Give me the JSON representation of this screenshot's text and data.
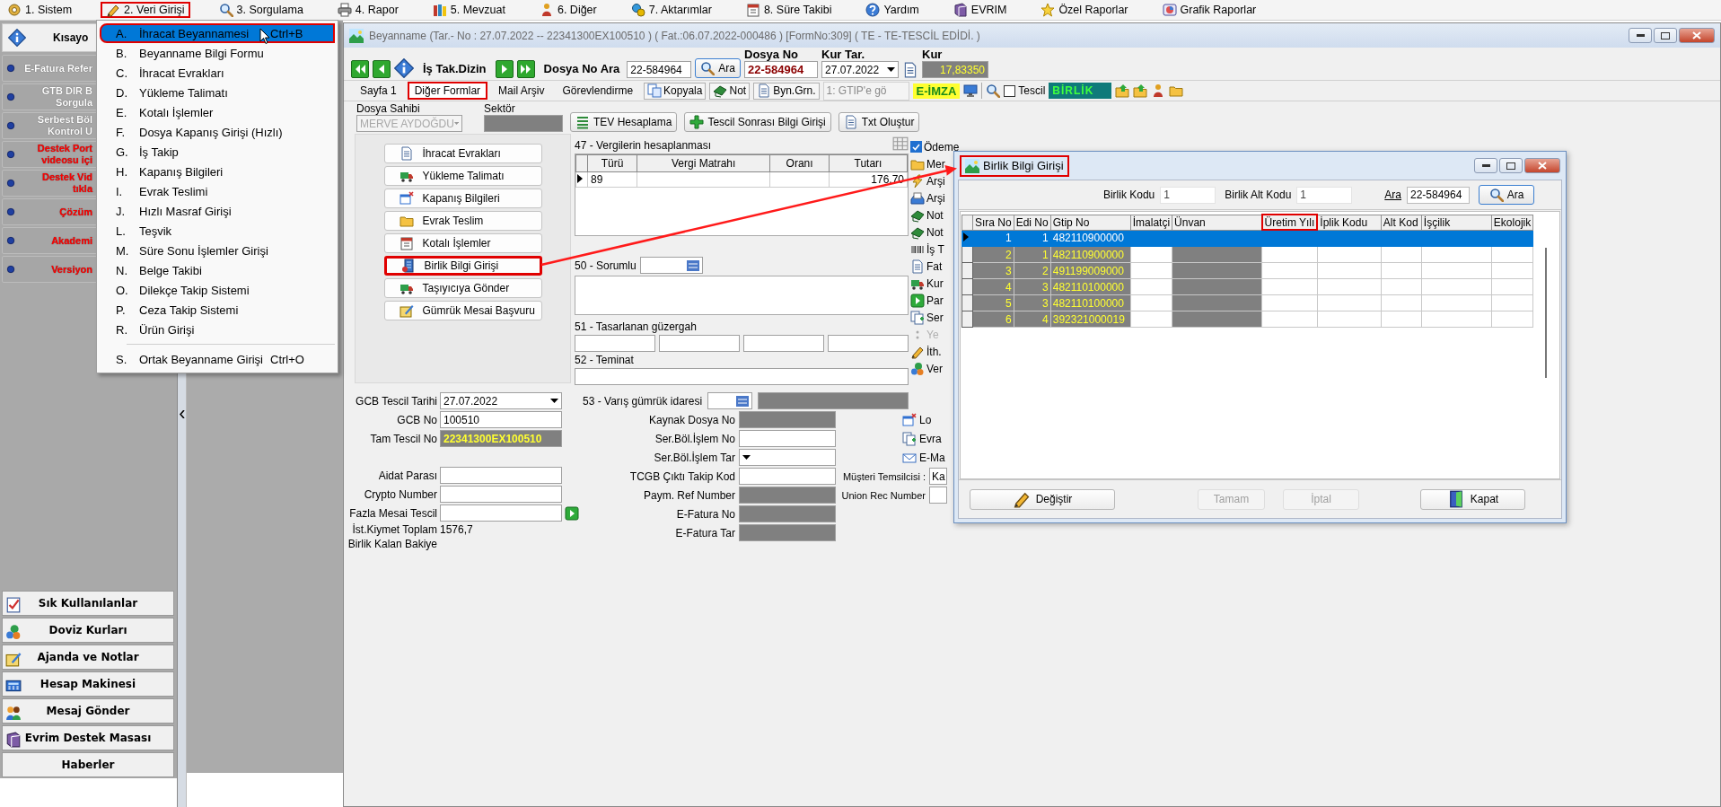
{
  "menu": [
    {
      "label": "1. Sistem",
      "highlighted": false
    },
    {
      "label": "2. Veri Girişi",
      "highlighted": true
    },
    {
      "label": "3. Sorgulama",
      "highlighted": false
    },
    {
      "label": "4. Rapor",
      "highlighted": false
    },
    {
      "label": "5. Mevzuat",
      "highlighted": false
    },
    {
      "label": "6. Diğer",
      "highlighted": false
    },
    {
      "label": "7. Aktarımlar",
      "highlighted": false
    },
    {
      "label": "8. Süre Takibi",
      "highlighted": false
    },
    {
      "label": "Yardım",
      "highlighted": false
    },
    {
      "label": "EVRIM",
      "highlighted": false
    },
    {
      "label": "Özel Raporlar",
      "highlighted": false
    },
    {
      "label": "Grafik Raporlar",
      "highlighted": false
    }
  ],
  "dropdown": {
    "items": [
      {
        "key": "A.",
        "label": "İhracat Beyannamesi",
        "shortcut": "Ctrl+B",
        "selected": true
      },
      {
        "key": "B.",
        "label": "Beyanname Bilgi Formu",
        "selected": false
      },
      {
        "key": "C.",
        "label": "İhracat Evrakları",
        "selected": false
      },
      {
        "key": "D.",
        "label": "Yükleme Talimatı",
        "selected": false
      },
      {
        "key": "E.",
        "label": "Kotalı İşlemler",
        "selected": false
      },
      {
        "key": "F.",
        "label": "Dosya Kapanış Girişi (Hızlı)",
        "selected": false
      },
      {
        "key": "G.",
        "label": "İş Takip",
        "selected": false
      },
      {
        "key": "H.",
        "label": "Kapanış Bilgileri",
        "selected": false
      },
      {
        "key": "I.",
        "label": "Evrak Teslimi",
        "selected": false
      },
      {
        "key": "J.",
        "label": "Hızlı Masraf Girişi",
        "selected": false
      },
      {
        "key": "L.",
        "label": "Teşvik",
        "selected": false
      },
      {
        "key": "M.",
        "label": "Süre Sonu İşlemler Girişi",
        "selected": false
      },
      {
        "key": "N.",
        "label": "Belge Takibi",
        "selected": false
      },
      {
        "key": "O.",
        "label": "Dilekçe Takip Sistemi",
        "selected": false
      },
      {
        "key": "P.",
        "label": "Ceza Takip Sistemi",
        "selected": false
      },
      {
        "key": "R.",
        "label": "Ürün Girişi",
        "selected": false
      }
    ],
    "footer_items": [
      {
        "key": "S.",
        "label": "Ortak Beyanname Girişi",
        "shortcut": "Ctrl+O",
        "selected": false
      }
    ]
  },
  "shortcuts": {
    "title": "Kısayo",
    "items": [
      {
        "label": "E-Fatura Refer",
        "color": "#ffffff"
      },
      {
        "label": "GTB DIR B\nSorgula",
        "color": "#ffffff"
      },
      {
        "label": "Serbest Böl\nKontrol U",
        "color": "#ffffff"
      },
      {
        "label": "Destek Port\nvideosu içi",
        "color": "#ff0000"
      },
      {
        "label": "Destek Vid\ntıkla",
        "color": "#ff0000"
      },
      {
        "label": "Çözüm",
        "color": "#ff0000"
      },
      {
        "label": "Akademi",
        "color": "#ff0000"
      },
      {
        "label": "Versiyon",
        "color": "#ff0000"
      }
    ]
  },
  "sidebar_buttons": [
    "Sık Kullanılanlar",
    "Doviz Kurları",
    "Ajanda ve Notlar",
    "Hesap Makinesi",
    "Mesaj Gönder",
    "Evrim Destek Masası",
    "Haberler"
  ],
  "window": {
    "title": "Beyanname (Tar.- No : 27.07.2022 -- 22341300EX100510 ) ( Fat.:06.07.2022-000486 )  [FormNo:309] ( TE - TE-TESCİL EDİDİ. )",
    "nav_label": "İş Tak.Dizin",
    "search_label": "Dosya No Ara",
    "search_value": "22-584964",
    "search_button": "Ara",
    "file_no_label": "Dosya No",
    "file_no": "22-584964",
    "rate_date_label": "Kur Tar.",
    "rate_date": "27.07.2022",
    "rate_label": "Kur",
    "rate": "17,83350"
  },
  "tabs": [
    {
      "label": "Sayfa 1",
      "selected": false,
      "highlighted": false
    },
    {
      "label": "Diğer Formlar",
      "selected": true,
      "highlighted": true
    },
    {
      "label": "Mail Arşiv",
      "selected": false,
      "highlighted": false
    },
    {
      "label": "Görevlendirme",
      "selected": false,
      "highlighted": false
    }
  ],
  "toolbar": {
    "buttons": [
      "Kopyala",
      "Not",
      "Byn.Grn."
    ],
    "gtip_combo": "1: GTIP'e gö",
    "esign": "E-İMZA",
    "tescil": {
      "label": "Tescil",
      "checked": false
    },
    "union_badge": "BİRLİK"
  },
  "owner": {
    "label": "Dosya Sahibi",
    "value": "MERVE AYDOĞDU",
    "disabled": true
  },
  "sector_label": "Sektör",
  "actions": [
    "TEV Hesaplama",
    "Tescil Sonrası Bilgi Girişi",
    "Txt Oluştur"
  ],
  "forms": [
    {
      "label": "İhracat Evrakları",
      "highlighted": false
    },
    {
      "label": "Yükleme Talimatı",
      "highlighted": false
    },
    {
      "label": "Kapanış Bilgileri",
      "highlighted": false
    },
    {
      "label": "Evrak Teslim",
      "highlighted": false
    },
    {
      "label": "Kotalı İşlemler",
      "highlighted": false
    },
    {
      "label": "Birlik Bilgi Girişi",
      "highlighted": true
    },
    {
      "label": "Taşıyıcıya Gönder",
      "highlighted": false
    },
    {
      "label": "Gümrük Mesai Başvuru",
      "highlighted": false
    }
  ],
  "tax": {
    "title": "47 - Vergilerin hesaplanması",
    "columns": [
      "Türü",
      "Vergi Matrahı",
      "Oranı",
      "Tutarı"
    ],
    "rows": [
      {
        "type_code": "89",
        "amount": "176,70"
      }
    ]
  },
  "responsible_label": "50 - Sorumlu",
  "route_label": "51 - Tasarlanan güzergah",
  "guarantee_label": "52 - Teminat",
  "side_items": [
    {
      "kind": "checkbox",
      "label": "Ödeme",
      "checked": true,
      "disabled": false
    },
    {
      "kind": "link",
      "label": "Mer",
      "disabled": false
    },
    {
      "kind": "link",
      "label": "Arşi",
      "disabled": false
    },
    {
      "kind": "link",
      "label": "Arşi",
      "disabled": false
    },
    {
      "kind": "link",
      "label": "Not",
      "disabled": false
    },
    {
      "kind": "link",
      "label": "Not",
      "disabled": false
    },
    {
      "kind": "link",
      "label": "İş T",
      "disabled": false
    },
    {
      "kind": "link",
      "label": "Fat",
      "disabled": false
    },
    {
      "kind": "link",
      "label": "Kur",
      "disabled": false
    },
    {
      "kind": "link",
      "label": "Par",
      "disabled": false
    },
    {
      "kind": "link",
      "label": "Ser",
      "disabled": false
    },
    {
      "kind": "link",
      "label": "Ye",
      "disabled": true
    },
    {
      "kind": "link",
      "label": "İth.",
      "disabled": false
    },
    {
      "kind": "link",
      "label": "Ver",
      "disabled": false
    }
  ],
  "registration_fields": [
    {
      "label": "GCB Tescil Tarihi",
      "kind": "combo",
      "value": "27.07.2022"
    },
    {
      "label": "GCB No",
      "kind": "text",
      "value": "100510"
    },
    {
      "label": "Tam Tescil No",
      "kind": "readonly",
      "value": "22341300EX100510"
    }
  ],
  "fee_fields": [
    {
      "label": "Aidat Parası",
      "kind": "text"
    },
    {
      "label": "Crypto Number",
      "kind": "text"
    },
    {
      "label": "Fazla Mesai Tescil",
      "kind": "action"
    },
    {
      "label": "İst.Kiymet Toplam",
      "kind": "static",
      "value": "1576,7"
    },
    {
      "label": "Birlik Kalan Bakiye",
      "kind": "static"
    }
  ],
  "destination_label": "53 - Varış gümrük idaresi",
  "reference_fields": [
    {
      "label": "Kaynak Dosya No",
      "kind": "readonly"
    },
    {
      "label": "Ser.Böl.İşlem No",
      "kind": "text"
    },
    {
      "label": "Ser.Böl.İşlem Tar",
      "kind": "combo"
    },
    {
      "label": "TCGB Çıktı Takip Kod",
      "kind": "text"
    },
    {
      "label": "Paym. Ref Number",
      "kind": "readonly"
    },
    {
      "label": "E-Fatura No",
      "kind": "readonly"
    },
    {
      "label": "E-Fatura Tar",
      "kind": "readonly"
    }
  ],
  "side_links": [
    "Lo",
    "Evra",
    "E-Ma"
  ],
  "contact_fields": [
    {
      "label": "Müşteri Temsilcisi :",
      "value": "Ka"
    },
    {
      "label": "Union Rec Number"
    }
  ],
  "dialog": {
    "title": "Birlik Bilgi Girişi",
    "highlighted": true,
    "code_label": "Birlik Kodu",
    "code": "1",
    "subcode_label": "Birlik Alt Kodu",
    "subcode": "1",
    "search_label": "Ara",
    "search_value": "22-584964",
    "search_button": "Ara",
    "columns": [
      {
        "label": "Sıra No",
        "readonly": true,
        "highlighted": false
      },
      {
        "label": "Edi No",
        "readonly": true,
        "highlighted": false
      },
      {
        "label": "Gtip No",
        "readonly": true,
        "highlighted": false
      },
      {
        "label": "İmalatçi",
        "readonly": false,
        "highlighted": false
      },
      {
        "label": "Ünvan",
        "readonly": true,
        "highlighted": false
      },
      {
        "label": "Üretim Yılı",
        "readonly": false,
        "highlighted": true
      },
      {
        "label": "İplik Kodu",
        "readonly": false,
        "highlighted": false
      },
      {
        "label": "Alt Kod",
        "readonly": false,
        "highlighted": false
      },
      {
        "label": "İşçilik",
        "readonly": false,
        "highlighted": false
      },
      {
        "label": "Ekolojik",
        "readonly": false,
        "highlighted": false
      }
    ],
    "rows": [
      {
        "selected": true,
        "cells": [
          "1",
          "1",
          "482110900000"
        ]
      },
      {
        "selected": false,
        "cells": [
          "2",
          "1",
          "482110900000"
        ]
      },
      {
        "selected": false,
        "cells": [
          "3",
          "2",
          "491199009000"
        ]
      },
      {
        "selected": false,
        "cells": [
          "4",
          "3",
          "482110100000"
        ]
      },
      {
        "selected": false,
        "cells": [
          "5",
          "3",
          "482110100000"
        ]
      },
      {
        "selected": false,
        "cells": [
          "6",
          "4",
          "392321000019"
        ]
      }
    ],
    "buttons": [
      {
        "label": "Değiştir",
        "disabled": false
      },
      {
        "label": "Tamam",
        "disabled": true
      },
      {
        "label": "İptal",
        "disabled": true
      },
      {
        "label": "Kapat",
        "disabled": false
      }
    ]
  }
}
